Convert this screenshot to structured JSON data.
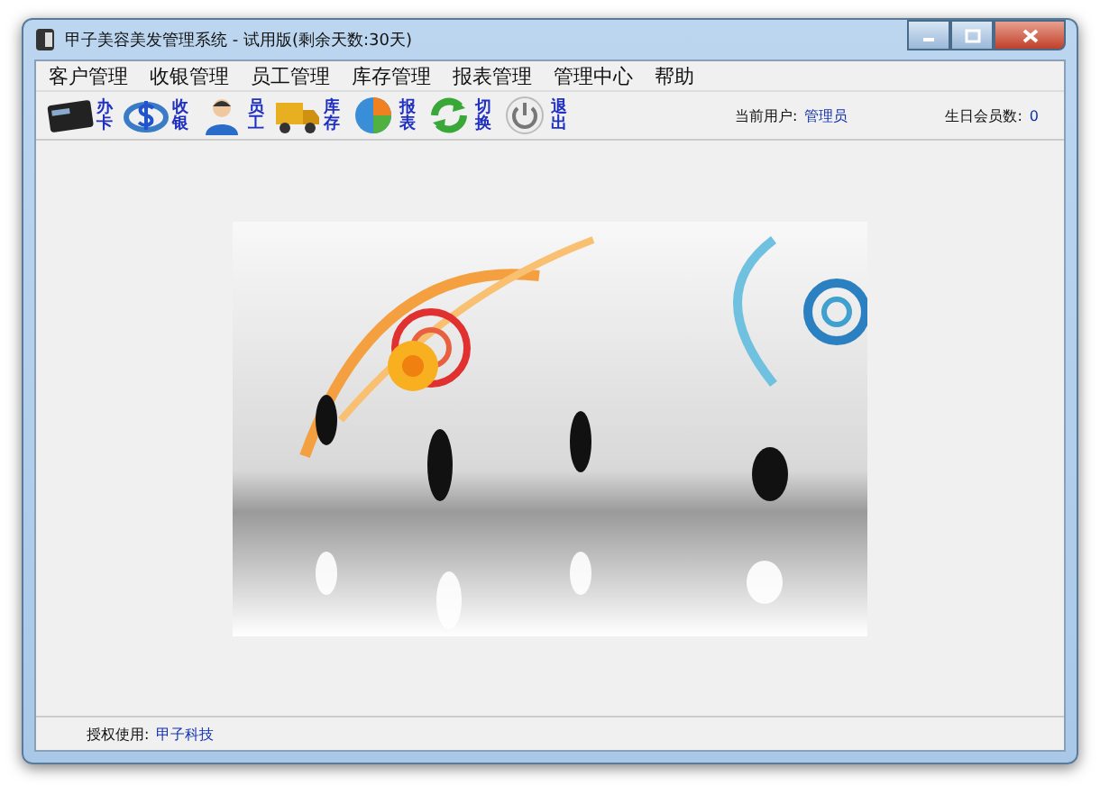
{
  "window": {
    "title": "甲子美容美发管理系统 - 试用版(剩余天数:30天)"
  },
  "menu": [
    "客户管理",
    "收银管理",
    "员工管理",
    "库存管理",
    "报表管理",
    "管理中心",
    "帮助"
  ],
  "toolbar": [
    {
      "kind": "card",
      "label": "办卡"
    },
    {
      "kind": "cashier",
      "label": "收银"
    },
    {
      "kind": "staff",
      "label": "员工"
    },
    {
      "kind": "stock",
      "label": "库存"
    },
    {
      "kind": "report",
      "label": "报表"
    },
    {
      "kind": "switch",
      "label": "切换"
    },
    {
      "kind": "exit",
      "label": "退出"
    }
  ],
  "current_user": {
    "label": "当前用户:",
    "value": "管理员"
  },
  "birthday_members": {
    "label": "生日会员数:",
    "value": "0"
  },
  "status_bar": {
    "label": "授权使用:",
    "value": "甲子科技"
  }
}
